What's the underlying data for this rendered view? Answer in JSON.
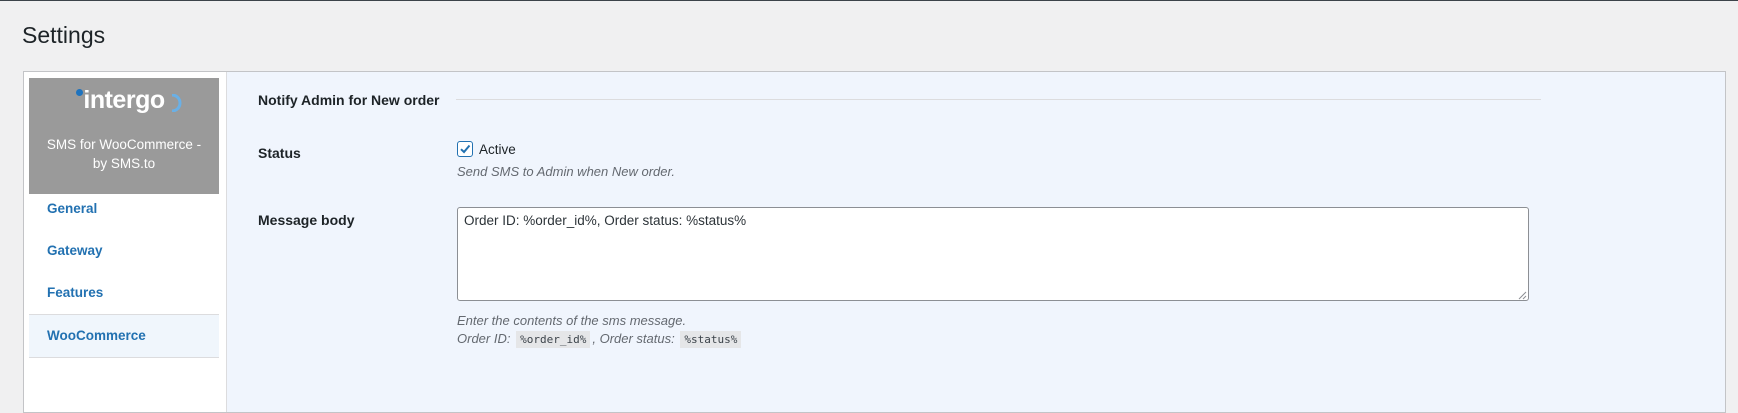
{
  "page": {
    "title": "Settings"
  },
  "sidebar": {
    "brand": {
      "logo_text": "intergo",
      "name": "SMS for WooCommerce - by SMS.to",
      "logo_icon": "intergo-logo"
    },
    "items": [
      {
        "label": "General",
        "active": false
      },
      {
        "label": "Gateway",
        "active": false
      },
      {
        "label": "Features",
        "active": false
      },
      {
        "label": "WooCommerce",
        "active": true
      }
    ]
  },
  "section": {
    "title": "Notify Admin for New order",
    "status": {
      "label": "Status",
      "checkbox_label": "Active",
      "checked": true,
      "description": "Send SMS to Admin when New order."
    },
    "message_body": {
      "label": "Message body",
      "value": "Order ID: %order_id%, Order status: %status%",
      "description": "Enter the contents of the sms message.",
      "vars": {
        "order_id_label": "Order ID:",
        "order_id_token": "%order_id%",
        "separator": ",",
        "status_label": "Order status:",
        "status_token": "%status%"
      }
    }
  },
  "colors": {
    "accent": "#2271b1",
    "brand_bg": "#9a9a9a",
    "content_bg": "#f0f5fd"
  }
}
